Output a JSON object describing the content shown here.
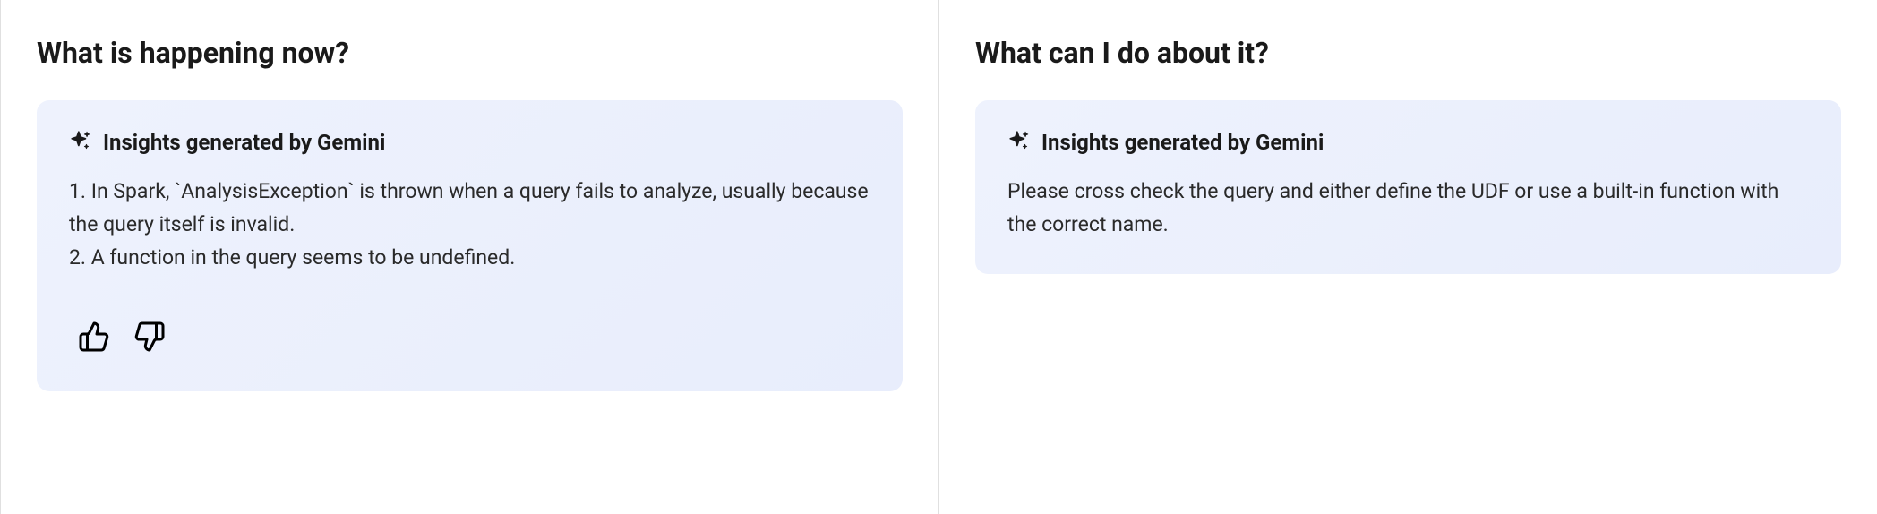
{
  "left": {
    "heading": "What is happening now?",
    "card_title": "Insights generated by Gemini",
    "body_line1": "1. In Spark, `AnalysisException` is thrown when a query fails to analyze, usually because the query itself is invalid.",
    "body_line2": "2. A function in the query seems to be undefined."
  },
  "right": {
    "heading": "What can I do about it?",
    "card_title": "Insights generated by Gemini",
    "body": "Please cross check the query and either define the UDF or use a built-in function with the correct name."
  }
}
